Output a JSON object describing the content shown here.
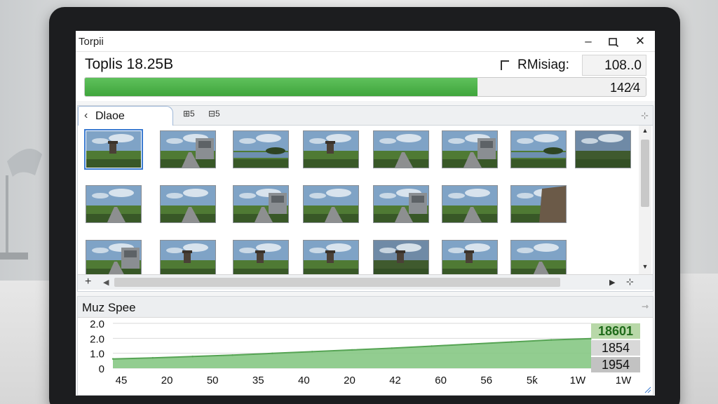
{
  "window": {
    "title": "Torpii",
    "min_glyph": "–",
    "close_glyph": "✕"
  },
  "header": {
    "title": "Toplis 18.25B",
    "remaining_label": "RMisiag:",
    "remaining_value": "108..0",
    "progress_fraction": 0.7,
    "progress_count": "142⁄4"
  },
  "image_pane": {
    "back_label": "Dlaoe",
    "back_glyph": "‹",
    "tab_icons": [
      "grid-view-icon",
      "filter-list-icon"
    ],
    "tab_icon_glyphs": [
      "⊞5",
      "⊟5"
    ],
    "pin_glyph": "⊹",
    "selected_index": 0,
    "thumbnails": [
      {
        "row": 0,
        "col": 0,
        "scene": "tower-field"
      },
      {
        "row": 0,
        "col": 1,
        "scene": "road-wall"
      },
      {
        "row": 0,
        "col": 2,
        "scene": "lake-shore"
      },
      {
        "row": 0,
        "col": 3,
        "scene": "tower-field"
      },
      {
        "row": 0,
        "col": 4,
        "scene": "road-field"
      },
      {
        "row": 0,
        "col": 5,
        "scene": "road-wall"
      },
      {
        "row": 0,
        "col": 6,
        "scene": "lake-trees"
      },
      {
        "row": 0,
        "col": 7,
        "scene": "meadow-dusk"
      },
      {
        "row": 1,
        "col": 0,
        "scene": "road-field"
      },
      {
        "row": 1,
        "col": 1,
        "scene": "road-field"
      },
      {
        "row": 1,
        "col": 2,
        "scene": "building-road"
      },
      {
        "row": 1,
        "col": 3,
        "scene": "road-field"
      },
      {
        "row": 1,
        "col": 4,
        "scene": "building-road"
      },
      {
        "row": 1,
        "col": 5,
        "scene": "road-field"
      },
      {
        "row": 1,
        "col": 6,
        "scene": "cliff-wall"
      },
      {
        "row": 2,
        "col": 0,
        "scene": "building-road"
      },
      {
        "row": 2,
        "col": 1,
        "scene": "tower-field"
      },
      {
        "row": 2,
        "col": 2,
        "scene": "tower-field"
      },
      {
        "row": 2,
        "col": 3,
        "scene": "tower-field"
      },
      {
        "row": 2,
        "col": 4,
        "scene": "tower-sunset"
      },
      {
        "row": 2,
        "col": 5,
        "scene": "tower-field"
      },
      {
        "row": 2,
        "col": 6,
        "scene": "road-horizon"
      }
    ],
    "add_glyph": "+",
    "scroll_end_glyph": "⊹"
  },
  "speed_pane": {
    "title": "Muz Spee",
    "pin_glyph": "⇾"
  },
  "chart_data": {
    "type": "area",
    "title": "",
    "xlabel": "",
    "ylabel": "",
    "y_tick_labels": [
      "2.0",
      "2.0",
      "1.0",
      "0"
    ],
    "x_tick_labels": [
      "45",
      "20",
      "50",
      "35",
      "40",
      "20",
      "42",
      "60",
      "56",
      "5ƙ",
      "1W",
      "1W"
    ],
    "series": [
      {
        "values": [
          0.27,
          0.3,
          0.34,
          0.38,
          0.43,
          0.48,
          0.53,
          0.58,
          0.64,
          0.7,
          0.76,
          0.82,
          0.86
        ],
        "color": "#7cc27a"
      }
    ],
    "ylim": [
      0,
      1.3
    ],
    "grid": true,
    "readout": [
      "18601",
      "1854",
      "1954"
    ]
  },
  "colors": {
    "progress": "#4cb54a",
    "selection": "#3b7bd1",
    "chart_fill": "#86c884",
    "chart_line": "#56a454"
  }
}
